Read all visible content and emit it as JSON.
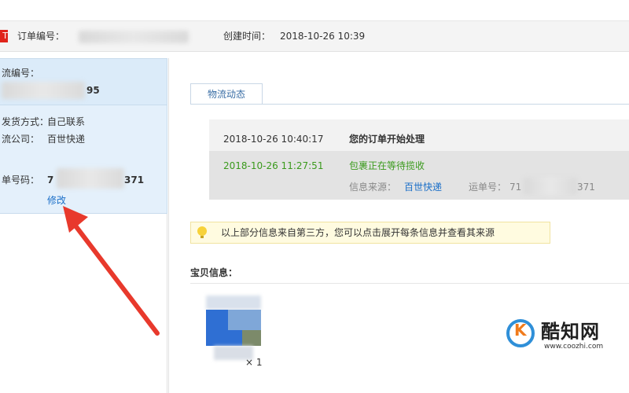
{
  "header": {
    "badge": "T",
    "order_no_label": "订单编号：",
    "created_label": "创建时间：",
    "created_value": "2018-10-26 10:39"
  },
  "left": {
    "tracking_label": "流编号：",
    "tracking_tail": "95",
    "ship_method_label": "发货方式：",
    "ship_method_value": "自己联系",
    "company_label": "流公司：",
    "company_value": "百世快递",
    "waybill_label": "单号码：",
    "waybill_head": "7",
    "waybill_tail": "371",
    "edit_link": "修改"
  },
  "main": {
    "tab_label": "物流动态",
    "log": [
      {
        "time": "2018-10-26 10:40:17",
        "text": "您的订单开始处理"
      },
      {
        "time": "2018-10-26 11:27:51",
        "text": "包裹正在等待揽收"
      }
    ],
    "source_label": "信息来源：",
    "source_value": "百世快递",
    "waybill_label": "运单号：",
    "waybill_head": "71",
    "waybill_tail": "371",
    "notice": "以上部分信息来自第三方，您可以点击展开每条信息并查看其来源",
    "goods_title": "宝贝信息：",
    "qty": "× 1"
  },
  "watermark": {
    "k": "K",
    "name": "酷知网",
    "url": "www.coozhi.com"
  },
  "colors": {
    "accent_blue": "#1b6fc8",
    "highlight_green": "#3a9a1c",
    "arrow_red": "#e8392c"
  }
}
